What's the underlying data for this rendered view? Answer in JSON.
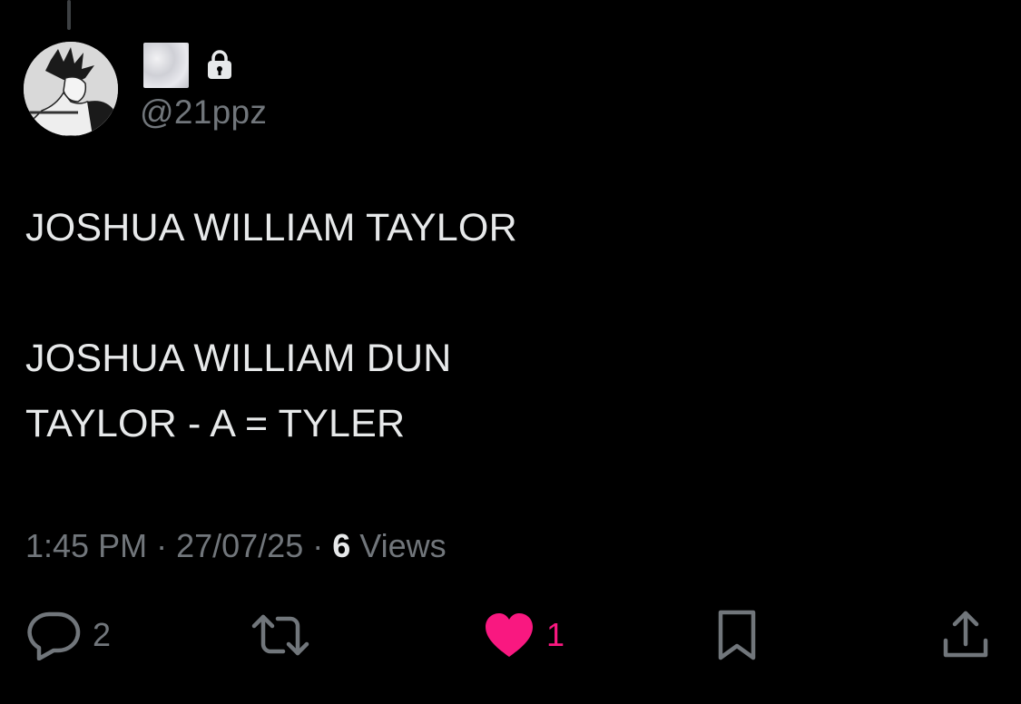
{
  "tweet": {
    "handle": "@21ppz",
    "lines": [
      "JOSHUA WILLIAM TAYLOR",
      "JOSHUA WILLIAM DUN",
      "TAYLOR - A = TYLER"
    ],
    "time": "1:45 PM",
    "date": "27/07/25",
    "views_count": "6",
    "views_label": "Views"
  },
  "actions": {
    "replies": "2",
    "likes": "1"
  },
  "icons": {
    "avatar": "avatar-image",
    "display_name": "display-name-image",
    "lock": "lock-icon",
    "reply": "reply-icon",
    "retweet": "retweet-icon",
    "like": "heart-icon",
    "bookmark": "bookmark-icon",
    "share": "share-icon"
  },
  "colors": {
    "background": "#000000",
    "text": "#e7e9ea",
    "muted": "#71767b",
    "like": "#f91880"
  }
}
